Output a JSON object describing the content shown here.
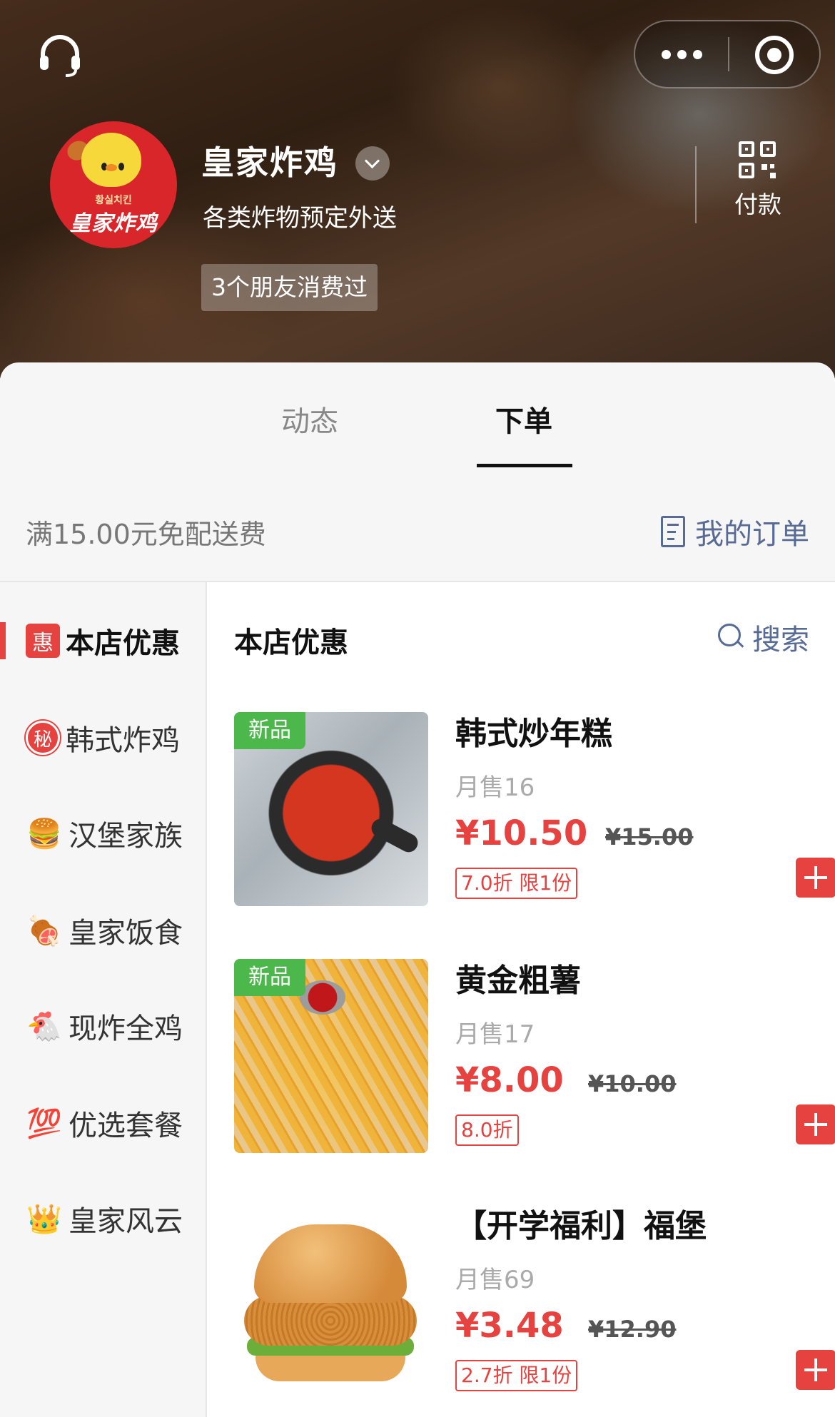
{
  "header": {
    "shop_name": "皇家炸鸡",
    "shop_desc": "各类炸物预定外送",
    "friends_badge": "3个朋友消费过",
    "pay_label": "付款",
    "logo_text_ko": "황실치킨",
    "logo_text_cn": "皇家炸鸡"
  },
  "tabs": [
    {
      "label": "动态"
    },
    {
      "label": "下单"
    }
  ],
  "delivery_notice": "满15.00元免配送费",
  "my_orders_label": "我的订单",
  "sidebar": {
    "items": [
      {
        "icon": "惠",
        "label": "本店优惠"
      },
      {
        "icon": "秘",
        "label": "韩式炸鸡"
      },
      {
        "icon": "🍔",
        "label": "汉堡家族"
      },
      {
        "icon": "🍖",
        "label": "皇家饭食"
      },
      {
        "icon": "🐔",
        "label": "现炸全鸡"
      },
      {
        "icon": "💯",
        "label": "优选套餐"
      },
      {
        "icon": "👑",
        "label": "皇家风云"
      }
    ]
  },
  "section": {
    "title": "本店优惠",
    "search_label": "搜索"
  },
  "products": [
    {
      "name": "韩式炒年糕",
      "new_tag": "新品",
      "sold": "月售16",
      "price": "¥10.50",
      "orig_price": "¥15.00",
      "discount": "7.0折 限1份"
    },
    {
      "name": "黄金粗薯",
      "new_tag": "新品",
      "sold": "月售17",
      "price": "¥8.00",
      "orig_price": "¥10.00",
      "discount": "8.0折"
    },
    {
      "name": "【开学福利】福堡",
      "new_tag": "",
      "sold": "月售69",
      "price": "¥3.48",
      "orig_price": "¥12.90",
      "discount": "2.7折 限1份"
    }
  ],
  "colors": {
    "accent_red": "#e64340",
    "link_blue": "#576b95",
    "new_green": "#4cb84c"
  }
}
